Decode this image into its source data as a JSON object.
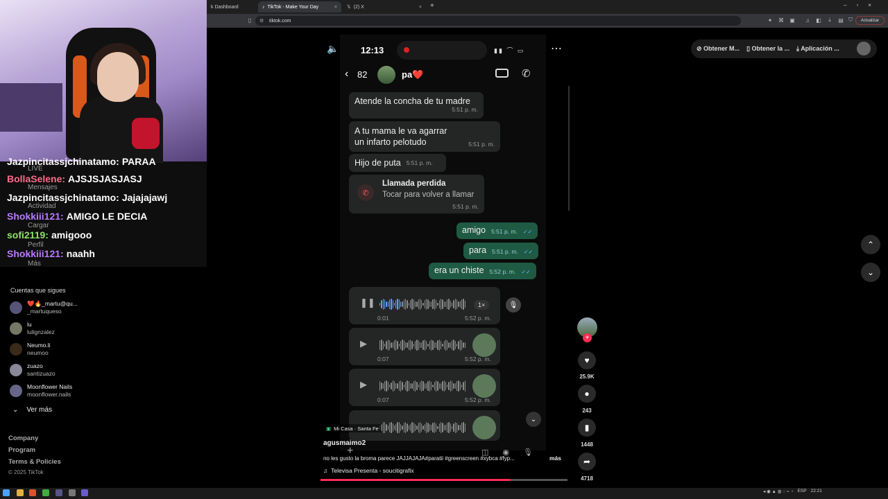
{
  "browser": {
    "tabs": [
      {
        "label": "k Dashboard"
      },
      {
        "label": "TikTok - Make Your Day"
      },
      {
        "label": "(2) X"
      }
    ],
    "new_tab": "+",
    "url": "tiktok.com",
    "update_label": "Actualizar"
  },
  "stream_overlay": {
    "chat": [
      {
        "user": "Jazpincitassjchinatamo:",
        "msg": "PARAA",
        "color": "#ffffff"
      },
      {
        "user": "BollaSelene:",
        "msg": "AJSJSJASJASJ",
        "color": "#ff6b8a"
      },
      {
        "user": "Jazpincitassjchinatamo:",
        "msg": "Jajajajawj",
        "color": "#ffffff"
      },
      {
        "user": "Shokkiii121:",
        "msg": "AMIGO LE DECIA",
        "color": "#b77bff"
      },
      {
        "user": "sofi2119:",
        "msg": "amigooo",
        "color": "#8fe36b"
      },
      {
        "user": "Shokkiii121:",
        "msg": "naahh",
        "color": "#b77bff"
      }
    ],
    "side_labels": [
      "LIVE",
      "Mensajes",
      "Actividad",
      "Cargar",
      "Perfil",
      "Más"
    ]
  },
  "sidebar": {
    "following_title": "Cuentas que sigues",
    "accounts": [
      {
        "name": "❤️🔥_martu@qu...",
        "handle": "_martuqueso"
      },
      {
        "name": "lu",
        "handle": "lulignzalez"
      },
      {
        "name": "Neumo.li",
        "handle": "neumoo"
      },
      {
        "name": "zuazo",
        "handle": "santizuazo"
      },
      {
        "name": "Moonflower Nails",
        "handle": "moonflower.nails"
      }
    ],
    "see_more": "Ver más",
    "footer": [
      "Company",
      "Program",
      "Terms & Policies"
    ],
    "copyright": "© 2025 TikTok"
  },
  "top_actions": [
    "Obtener M...",
    "Obtener la ...",
    "Aplicación ..."
  ],
  "phone": {
    "clock": "12:13",
    "back_count": "82",
    "contact_name": "pa❤️",
    "messages": [
      {
        "text": "Atende la concha de tu madre",
        "time": "5:51 p. m."
      },
      {
        "text": "A tu mama le va agarrar un infarto pelotudo",
        "time": "5:51 p. m."
      },
      {
        "text": "Hijo de puta",
        "time": "5:51 p. m."
      }
    ],
    "missed_call": {
      "title": "Llamada perdida",
      "subtitle": "Tocar para volver a llamar",
      "time": "5:51 p. m."
    },
    "outgoing": [
      {
        "text": "amigo",
        "time": "5:51 p. m."
      },
      {
        "text": "para",
        "time": "5:51 p. m."
      },
      {
        "text": "era un chiste",
        "time": "5:52 p. m."
      }
    ],
    "audios": [
      {
        "duration": "0:01",
        "time": "5:52 p. m.",
        "speed": "1×"
      },
      {
        "duration": "0:07",
        "time": "5:52 p. m."
      },
      {
        "duration": "0:07",
        "time": "5:52 p. m."
      }
    ]
  },
  "video": {
    "location_tag": "Mi Casa · Santa Fe",
    "author": "agusmaimo2",
    "caption": "no les gusto la broma parece JAJJAJAJA#paratii #greenscreen #xybca #fyp...",
    "more": "más",
    "music": "Televisa Presenta - soucitigrafix",
    "progress": 0.77
  },
  "rail": {
    "likes": "25.9K",
    "comments": "243",
    "saves": "1448",
    "shares": "4718"
  },
  "taskbar": {
    "lang": "ESP",
    "time": "22:21"
  }
}
